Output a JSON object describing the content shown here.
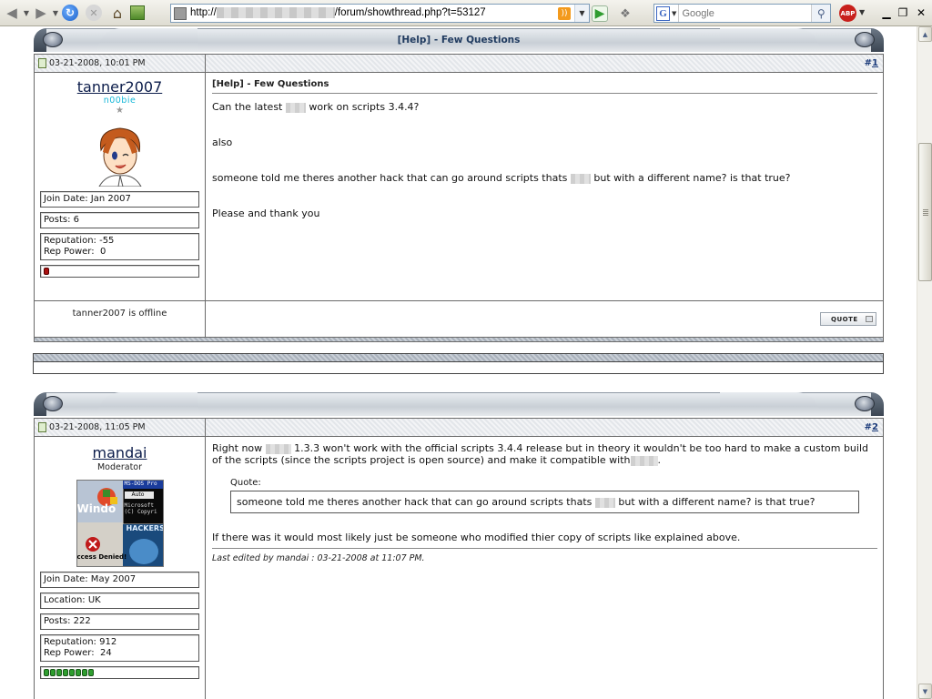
{
  "browser": {
    "url_prefix": "http://",
    "url_suffix": "/forum/showthread.php?t=53127",
    "search_placeholder": "Google",
    "search_engine_letter": "G",
    "adblock_label": "ABP"
  },
  "posts": [
    {
      "header_title": "[Help] - Few Questions",
      "date": "03-21-2008, 10:01 PM",
      "number": "1",
      "username": "tanner2007",
      "usertitle": "n00bie",
      "star": "★",
      "info": {
        "join_date": "Join Date: Jan 2007",
        "posts": "Posts: 6",
        "reputation": "Reputation: -55",
        "rep_power": "Rep Power:  0"
      },
      "rep_dot_count": 1,
      "message_title": "[Help] - Few Questions",
      "paragraphs": {
        "p1a": "Can the latest",
        "p1b": "work on scripts 3.4.4?",
        "p2": "also",
        "p3a": "someone told me theres another hack that can go around scripts thats",
        "p3b": "but with a different name? is that true?",
        "p4": "Please and thank you"
      },
      "status": "tanner2007 is offline",
      "quote_label": "QUOTE"
    },
    {
      "header_title": "",
      "date": "03-21-2008, 11:05 PM",
      "number": "2",
      "username": "mandai",
      "usertitle": "Moderator",
      "info": {
        "join_date": "Join Date: May 2007",
        "location": "Location: UK",
        "posts": "Posts: 222",
        "reputation": "Reputation: 912",
        "rep_power": "Rep Power:  24"
      },
      "rep_dot_count": 8,
      "message": {
        "p1a": "Right now",
        "p1b": "1.3.3 won't work with the official scripts 3.4.4 release but in theory it wouldn't be too hard to make a custom build of the scripts (since the scripts project is open source) and make it compatible with",
        "p1c": ".",
        "quote_label": "Quote:",
        "quote_a": "someone told me theres another hack that can go around scripts thats",
        "quote_b": "but with a different name? is that true?",
        "p2": "If there was it would most likely just be someone who modified thier copy of scripts like explained above.",
        "edited": "Last edited by mandai : 03-21-2008 at 11:07 PM."
      }
    }
  ],
  "avatar_text": {
    "msdos": "MS-DOS Pro",
    "auto": "Auto",
    "microsoft": "Microsoft",
    "copyright": "(C) Copyri",
    "windows": "Windo",
    "hackers": "HACKERS",
    "denied": "ccess Denied!"
  },
  "colors": {
    "username_link": "#0b1c4a",
    "noobie_title": "#18b8d9",
    "header_title": "#1f3a5f",
    "post_number": "#1a3a7a"
  }
}
